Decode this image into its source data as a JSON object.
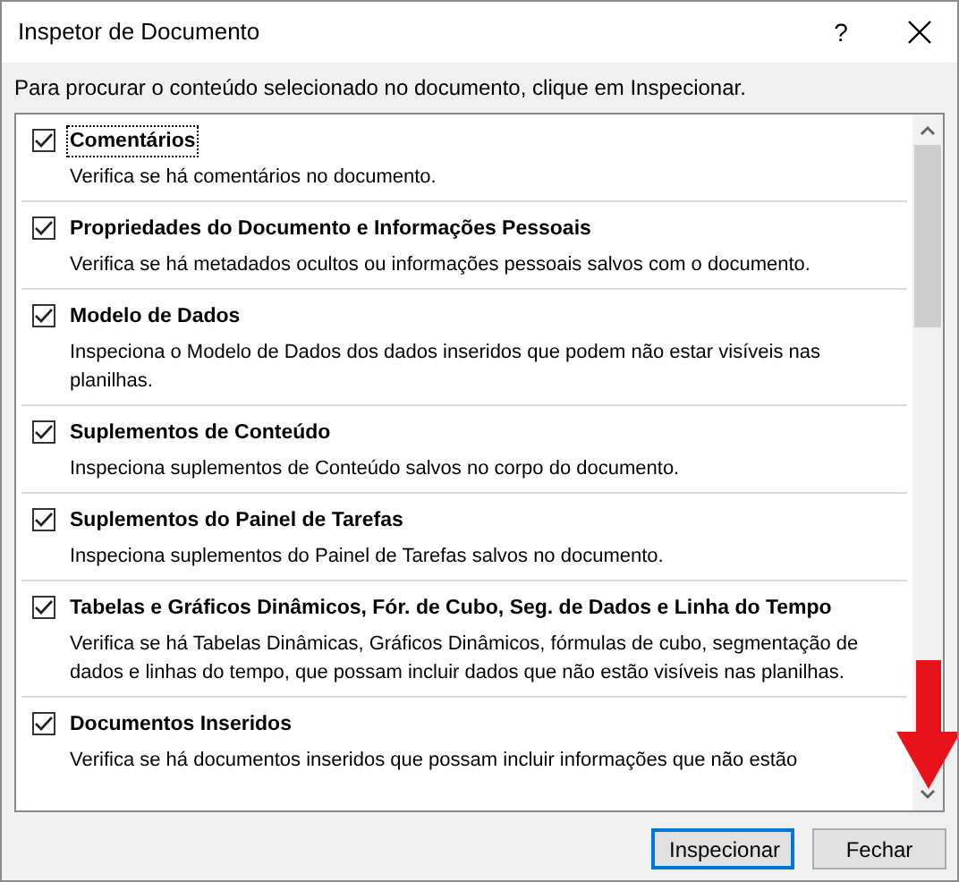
{
  "window": {
    "title": "Inspetor de Documento",
    "help": "?"
  },
  "instruction": "Para procurar o conteúdo selecionado no documento, clique em Inspecionar.",
  "items": [
    {
      "title": "Comentários",
      "description": "Verifica se há comentários no documento.",
      "checked": true,
      "focused": true
    },
    {
      "title": "Propriedades do Documento e Informações Pessoais",
      "description": "Verifica se há metadados ocultos ou informações pessoais salvos com o documento.",
      "checked": true,
      "focused": false
    },
    {
      "title": "Modelo de Dados",
      "description": "Inspeciona o Modelo de Dados dos dados inseridos que podem não estar visíveis nas planilhas.",
      "checked": true,
      "focused": false
    },
    {
      "title": "Suplementos de Conteúdo",
      "description": "Inspeciona suplementos de Conteúdo salvos no corpo do documento.",
      "checked": true,
      "focused": false
    },
    {
      "title": "Suplementos do Painel de Tarefas",
      "description": "Inspeciona suplementos do Painel de Tarefas salvos no documento.",
      "checked": true,
      "focused": false
    },
    {
      "title": "Tabelas e Gráficos Dinâmicos, Fór. de Cubo, Seg. de Dados e Linha do Tempo",
      "description": "Verifica se há Tabelas Dinâmicas, Gráficos Dinâmicos, fórmulas de cubo, segmentação de dados e linhas do tempo, que possam incluir dados que não estão visíveis nas planilhas.",
      "checked": true,
      "focused": false
    },
    {
      "title": "Documentos Inseridos",
      "description": "Verifica se há documentos inseridos que possam incluir informações que não estão",
      "checked": true,
      "focused": false
    }
  ],
  "buttons": [
    {
      "label": "Inspecionar",
      "default": true
    },
    {
      "label": "Fechar",
      "default": false
    }
  ]
}
